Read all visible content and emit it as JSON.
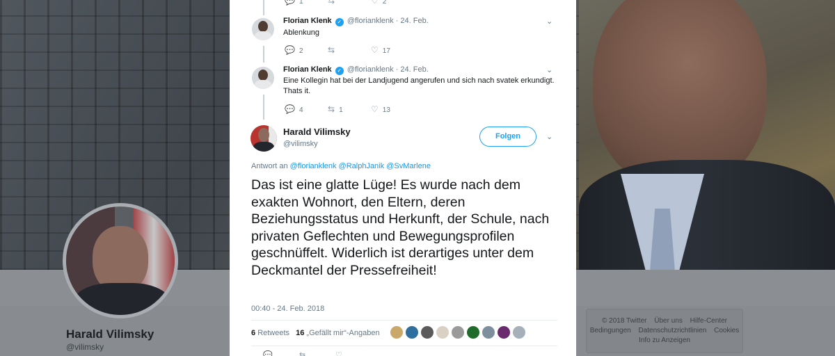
{
  "background": {
    "profile_name": "Harald Vilimsky",
    "profile_handle": "@vilimsky",
    "footer_links": [
      "© 2018 Twitter",
      "Über uns",
      "Hilfe-Center",
      "Bedingungen",
      "Datenschutzrichtlinien",
      "Cookies",
      "Info zu Anzeigen"
    ]
  },
  "thread": {
    "top_counts": {
      "replies": "1",
      "likes": "2"
    },
    "replies": [
      {
        "name": "Florian Klenk",
        "handle": "@florianklenk",
        "date": "· 24. Feb.",
        "text": "Ablenkung",
        "reply_count": "2",
        "retweet_count": "",
        "like_count": "17"
      },
      {
        "name": "Florian Klenk",
        "handle": "@florianklenk",
        "date": "· 24. Feb.",
        "text_lines": [
          "Eine Kollegin hat bei der Landjugend angerufen und sich nach svatek erkundigt.",
          "Thats it."
        ],
        "reply_count": "4",
        "retweet_count": "1",
        "like_count": "13"
      }
    ]
  },
  "main_tweet": {
    "name": "Harald Vilimsky",
    "handle": "@vilimsky",
    "follow_label": "Folgen",
    "reply_prefix": "Antwort an",
    "reply_mentions": [
      "@florianklenk",
      "@RalphJanik",
      "@SvMarlene"
    ],
    "text": "Das ist eine glatte Lüge! Es wurde nach dem exakten Wohnort, den Eltern, deren Beziehungsstatus und Herkunft, der Schule, nach privaten Geflechten und Bewegungsprofilen geschnüffelt. Widerlich ist derartiges unter dem Deckmantel der Pressefreiheit!",
    "timestamp": "00:40 - 24. Feb. 2018",
    "retweets": "6",
    "retweets_label": "Retweets",
    "likes": "16",
    "likes_label": "„Gefällt mir“-Angaben",
    "liker_colors": [
      "#c9a86a",
      "#2f6f9e",
      "#5a5a5a",
      "#d9d2c4",
      "#9a9a9a",
      "#1f6b2a",
      "#7d8f9c",
      "#6a2a6e",
      "#a5b0b8"
    ]
  },
  "icons": [
    "reply-icon",
    "retweet-icon",
    "like-icon",
    "verified-icon",
    "chevron-down-icon"
  ]
}
